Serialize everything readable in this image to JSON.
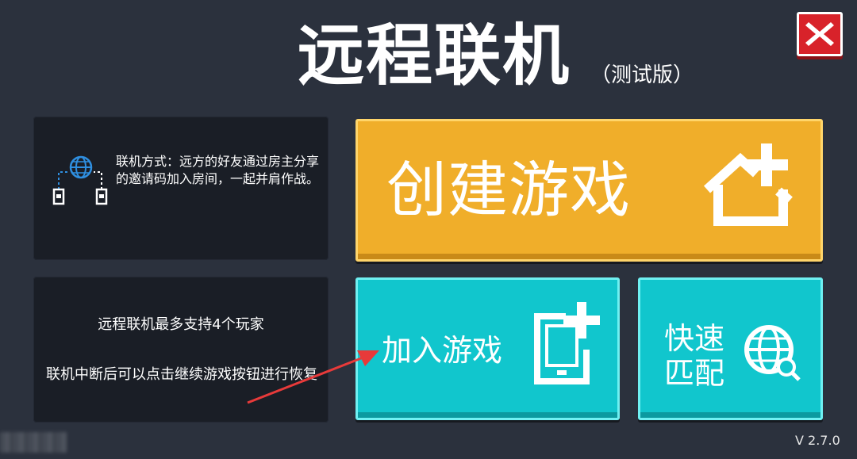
{
  "header": {
    "title": "远程联机",
    "subtitle": "（测试版）",
    "close_icon": "close-x-icon"
  },
  "info_panel": {
    "icon": "network-globe-icon",
    "text": "联机方式：远方的好友通过房主分享的邀请码加入房间，一起并肩作战。"
  },
  "tips_panel": {
    "tip_max_players": "远程联机最多支持4个玩家",
    "tip_resume": "联机中断后可以点击继续游戏按钮进行恢复"
  },
  "buttons": {
    "create_label": "创建游戏",
    "create_icon": "house-plus-icon",
    "join_label": "加入游戏",
    "join_icon": "tablet-plus-icon",
    "quick_label": "快速匹配",
    "quick_icon": "globe-search-icon"
  },
  "footer": {
    "version": "V 2.7.0"
  },
  "colors": {
    "background": "#2b313d",
    "panel": "#1a1e26",
    "create_button": "#f0ae2a",
    "join_button": "#11c6cd",
    "close_button": "#d8222a",
    "arrow": "#e83a3a"
  }
}
